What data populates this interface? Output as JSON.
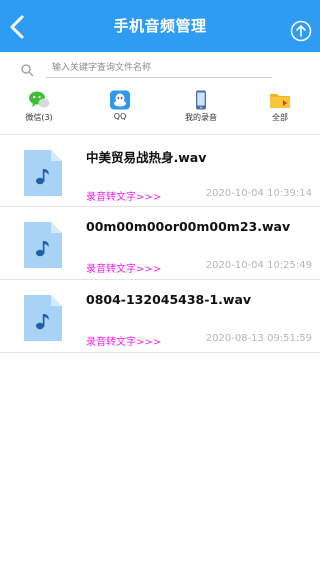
{
  "header": {
    "title": "手机音频管理",
    "back_icon": "back-chevron-icon",
    "upload_icon": "upload-circle-icon",
    "color": "#2e9cf3"
  },
  "search": {
    "placeholder": "输入关键字查询文件名称",
    "value": "",
    "icon": "search-icon"
  },
  "categories": [
    {
      "label": "微信(3)",
      "icon": "wechat-icon"
    },
    {
      "label": "QQ",
      "icon": "qq-icon"
    },
    {
      "label": "我的录音",
      "icon": "phone-icon"
    },
    {
      "label": "全部",
      "icon": "folder-icon"
    }
  ],
  "files": [
    {
      "name": "中美贸易战热身.wav",
      "action": "录音转文字>>>",
      "time": "2020-10-04 10:39:14"
    },
    {
      "name": "00m00m00or00m00m23.wav",
      "action": "录音转文字>>>",
      "time": "2020-10-04 10:25:49"
    },
    {
      "name": "0804-132045438-1.wav",
      "action": "录音转文字>>>",
      "time": "2020-08-13 09:51:59"
    }
  ],
  "colors": {
    "accent": "#2e9cf3",
    "action_text": "#ee22ee",
    "timestamp": "#b5b5b5",
    "file_icon": "#a9d2f7"
  }
}
